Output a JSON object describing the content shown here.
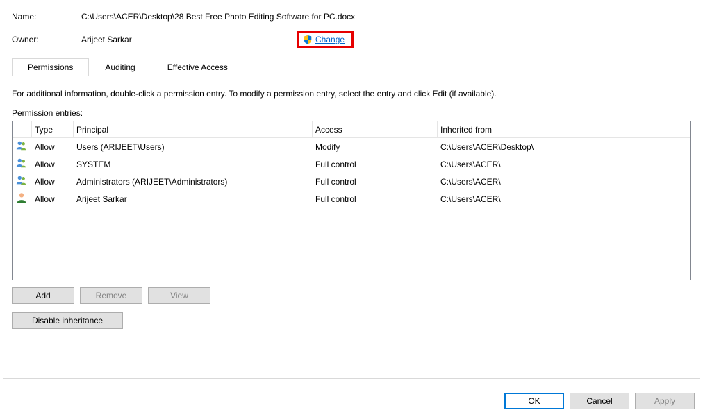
{
  "info": {
    "name_label": "Name:",
    "name_value": "C:\\Users\\ACER\\Desktop\\28 Best Free Photo Editing Software for PC.docx",
    "owner_label": "Owner:",
    "owner_value": "Arijeet Sarkar",
    "change_link": "Change"
  },
  "tabs": {
    "permissions": "Permissions",
    "auditing": "Auditing",
    "effective": "Effective Access"
  },
  "instructions": "For additional information, double-click a permission entry. To modify a permission entry, select the entry and click Edit (if available).",
  "entries_label": "Permission entries:",
  "columns": {
    "type": "Type",
    "principal": "Principal",
    "access": "Access",
    "inherited": "Inherited from"
  },
  "entries": [
    {
      "icon": "users",
      "type": "Allow",
      "principal": "Users (ARIJEET\\Users)",
      "access": "Modify",
      "inherited": "C:\\Users\\ACER\\Desktop\\"
    },
    {
      "icon": "users",
      "type": "Allow",
      "principal": "SYSTEM",
      "access": "Full control",
      "inherited": "C:\\Users\\ACER\\"
    },
    {
      "icon": "users",
      "type": "Allow",
      "principal": "Administrators (ARIJEET\\Administrators)",
      "access": "Full control",
      "inherited": "C:\\Users\\ACER\\"
    },
    {
      "icon": "user",
      "type": "Allow",
      "principal": "Arijeet Sarkar",
      "access": "Full control",
      "inherited": "C:\\Users\\ACER\\"
    }
  ],
  "buttons": {
    "add": "Add",
    "remove": "Remove",
    "view": "View",
    "disable_inheritance": "Disable inheritance",
    "ok": "OK",
    "cancel": "Cancel",
    "apply": "Apply"
  }
}
